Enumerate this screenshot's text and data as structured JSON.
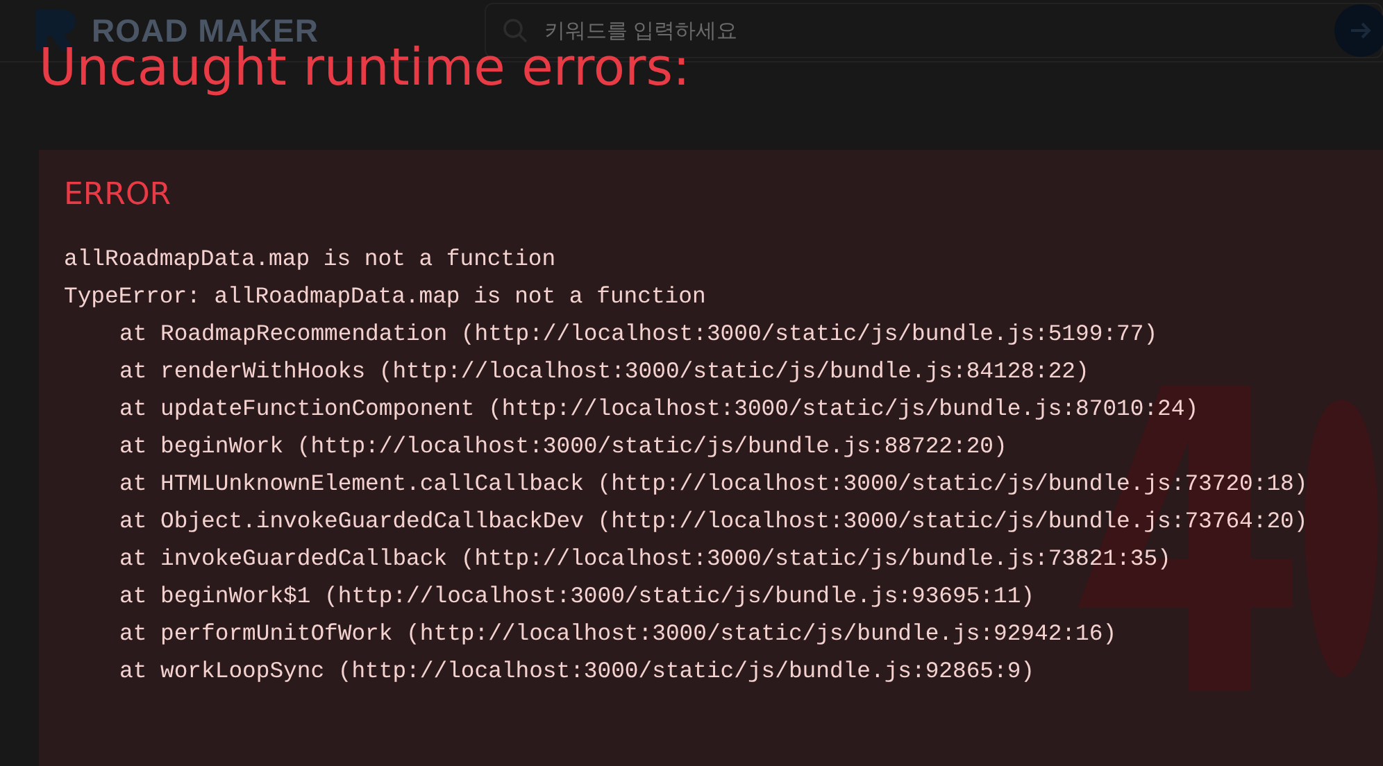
{
  "header": {
    "logo": "ROAD MAKER",
    "search": {
      "placeholder": "키워드를 입력하세요"
    }
  },
  "overlay": {
    "title": "Uncaught runtime errors:",
    "errors": [
      {
        "heading": "ERROR",
        "message": "allRoadmapData.map is not a function",
        "stack": [
          {
            "kind": "head",
            "text": "TypeError: allRoadmapData.map is not a function"
          },
          {
            "kind": "frame",
            "text": "at RoadmapRecommendation (http://localhost:3000/static/js/bundle.js:5199:77)"
          },
          {
            "kind": "frame",
            "text": "at renderWithHooks (http://localhost:3000/static/js/bundle.js:84128:22)"
          },
          {
            "kind": "frame",
            "text": "at updateFunctionComponent (http://localhost:3000/static/js/bundle.js:87010:24)"
          },
          {
            "kind": "frame",
            "text": "at beginWork (http://localhost:3000/static/js/bundle.js:88722:20)"
          },
          {
            "kind": "frame",
            "text": "at HTMLUnknownElement.callCallback (http://localhost:3000/static/js/bundle.js:73720:18)"
          },
          {
            "kind": "frame",
            "text": "at Object.invokeGuardedCallbackDev (http://localhost:3000/static/js/bundle.js:73764:20)"
          },
          {
            "kind": "frame",
            "text": "at invokeGuardedCallback (http://localhost:3000/static/js/bundle.js:73821:35)"
          },
          {
            "kind": "frame",
            "text": "at beginWork$1 (http://localhost:3000/static/js/bundle.js:93695:11)"
          },
          {
            "kind": "frame",
            "text": "at performUnitOfWork (http://localhost:3000/static/js/bundle.js:92942:16)"
          },
          {
            "kind": "frame",
            "text": "at workLoopSync (http://localhost:3000/static/js/bundle.js:92865:9)"
          }
        ]
      }
    ]
  }
}
